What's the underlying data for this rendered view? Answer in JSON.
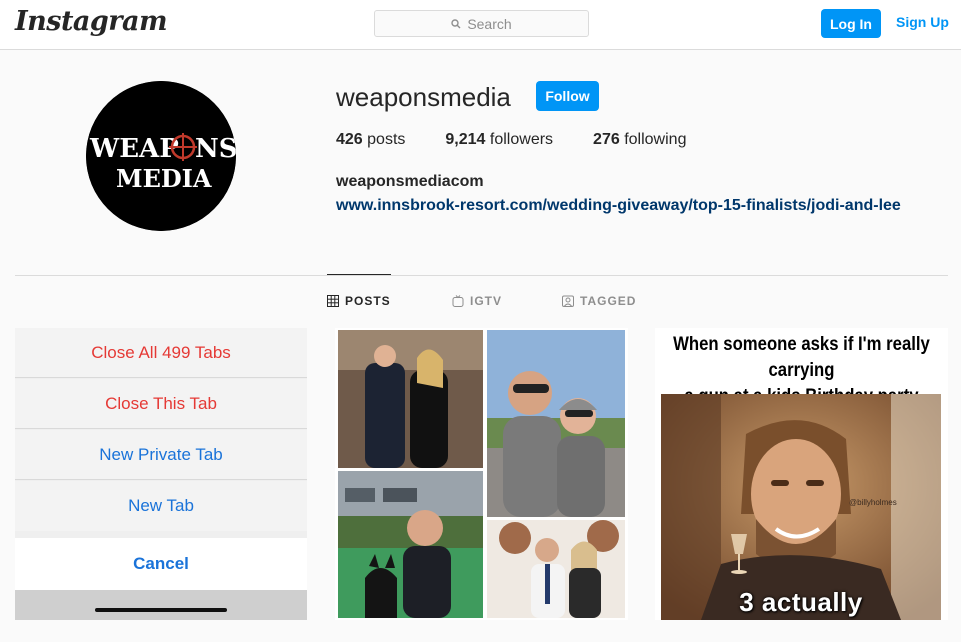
{
  "header": {
    "logo": "Instagram",
    "search_placeholder": "Search",
    "login_label": "Log In",
    "signup_label": "Sign Up"
  },
  "profile": {
    "username": "weaponsmedia",
    "follow_label": "Follow",
    "posts_count": "426",
    "posts_label": "posts",
    "followers_count": "9,214",
    "followers_label": "followers",
    "following_count": "276",
    "following_label": "following",
    "full_name": "weaponsmediacom",
    "bio_link": "www.innsbrook-resort.com/wedding-giveaway/top-15-finalists/jodi-and-lee",
    "avatar_text": [
      "WEAP",
      "NS",
      "MEDIA"
    ]
  },
  "tabs": [
    {
      "label": "POSTS",
      "icon": "grid-icon",
      "active": true
    },
    {
      "label": "IGTV",
      "icon": "igtv-icon",
      "active": false
    },
    {
      "label": "TAGGED",
      "icon": "tagged-icon",
      "active": false
    }
  ],
  "posts": {
    "post1": {
      "items": [
        "Close All 499 Tabs",
        "Close This Tab",
        "New Private Tab",
        "New Tab"
      ],
      "cancel": "Cancel"
    },
    "post3": {
      "caption_line1": "When someone asks if I'm really carrying",
      "caption_line2": "a gun at a kids Birthday party",
      "watermark": "@billyholmes",
      "bottom_text": "3 actually"
    }
  },
  "colors": {
    "accent": "#0095f6",
    "link": "#00376b",
    "destructive": "#e53935",
    "ios_blue": "#1a73d9"
  }
}
